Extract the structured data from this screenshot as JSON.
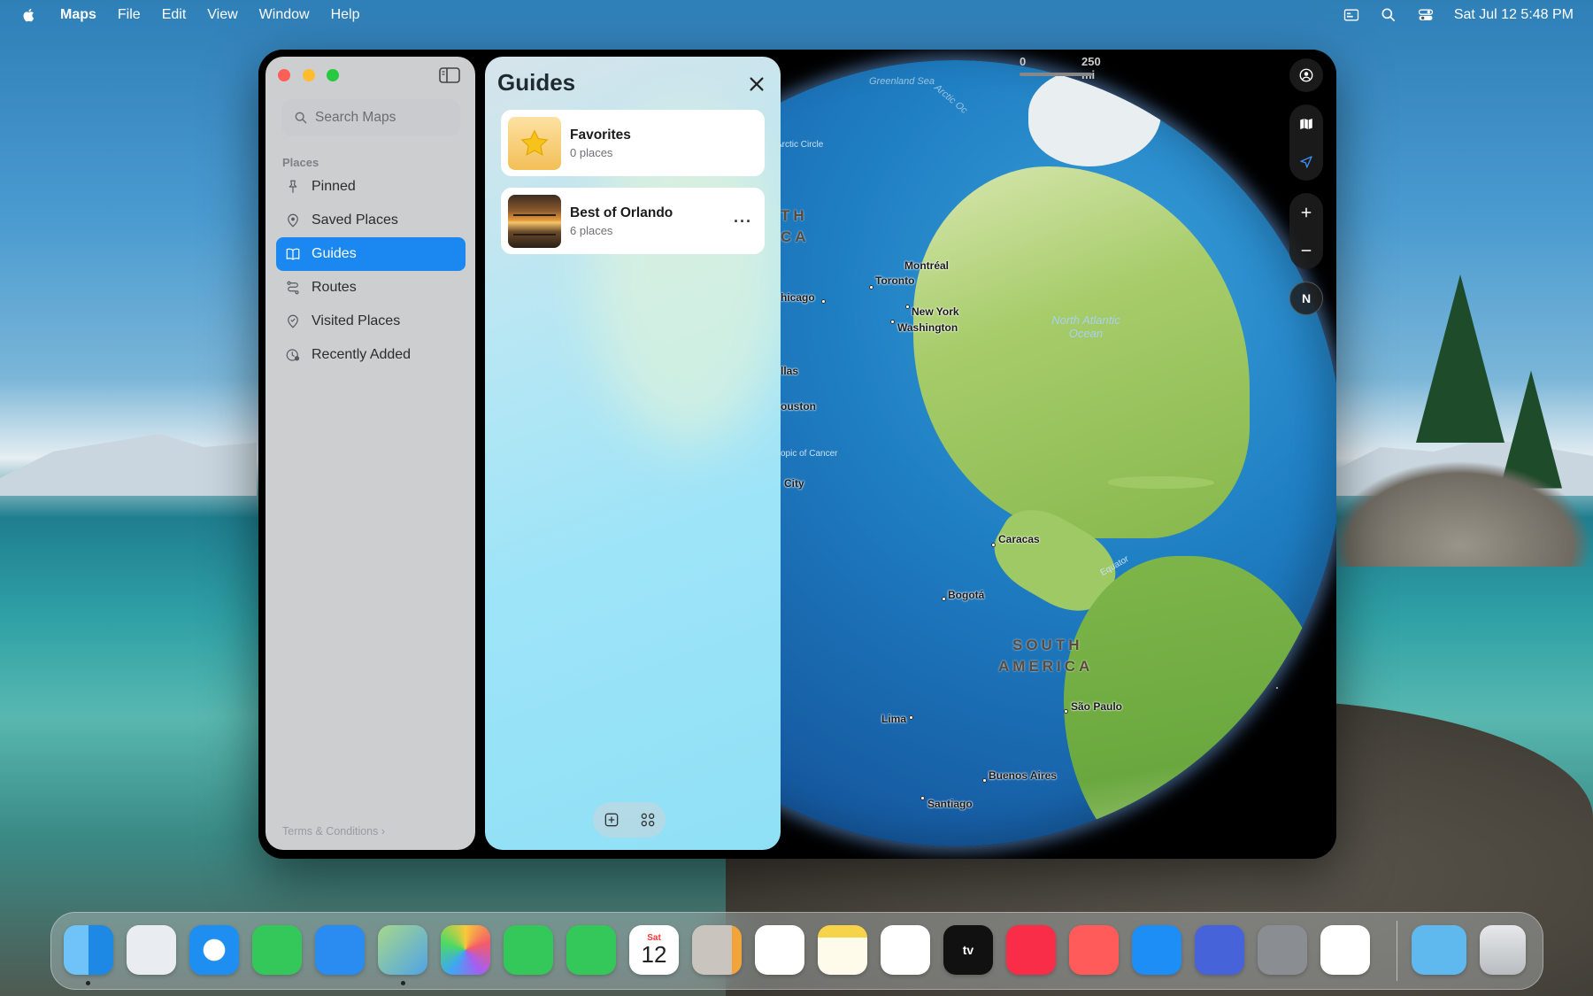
{
  "menubar": {
    "app_name": "Maps",
    "menus": [
      "File",
      "Edit",
      "View",
      "Window",
      "Help"
    ],
    "date_time": "Sat Jul 12  5:48 PM"
  },
  "sidebar": {
    "search_placeholder": "Search Maps",
    "section_title": "Places",
    "items": [
      {
        "label": "Pinned",
        "icon": "pin-icon"
      },
      {
        "label": "Saved Places",
        "icon": "location-pin-icon"
      },
      {
        "label": "Guides",
        "icon": "book-icon",
        "active": true
      },
      {
        "label": "Routes",
        "icon": "route-icon"
      },
      {
        "label": "Visited Places",
        "icon": "visited-icon"
      },
      {
        "label": "Recently Added",
        "icon": "recent-icon"
      }
    ],
    "terms": "Terms & Conditions"
  },
  "guides": {
    "title": "Guides",
    "cards": [
      {
        "title": "Favorites",
        "subtitle": "0 places"
      },
      {
        "title": "Best of Orlando",
        "subtitle": "6 places"
      }
    ]
  },
  "map": {
    "scale_start": "0",
    "scale_end": "250 mi",
    "compass": "N",
    "labels": {
      "greenland_sea": "Greenland Sea",
      "arctic_ocean": "Arctic Oc",
      "arctic_circle": "Arctic Circle",
      "north_america_1": "TH",
      "north_america_2": "CA",
      "montreal": "Montréal",
      "toronto": "Toronto",
      "chicago": "hicago",
      "new_york": "New York",
      "washington": "Washington",
      "north_atlantic": "North Atlantic Ocean",
      "dallas": "llas",
      "houston": "ouston",
      "tropic": "opic of Cancer",
      "mexico_city": "City",
      "caracas": "Caracas",
      "equator": "Equator",
      "bogota": "Bogotá",
      "south_america_1": "SOUTH",
      "south_america_2": "AMERICA",
      "sao_paulo": "São Paulo",
      "lima": "Lima",
      "buenos_aires": "Buenos Aires",
      "santiago": "Santiago"
    }
  },
  "dock": {
    "calendar_month": "Sat",
    "calendar_day": "12",
    "tv_label": "tv"
  }
}
